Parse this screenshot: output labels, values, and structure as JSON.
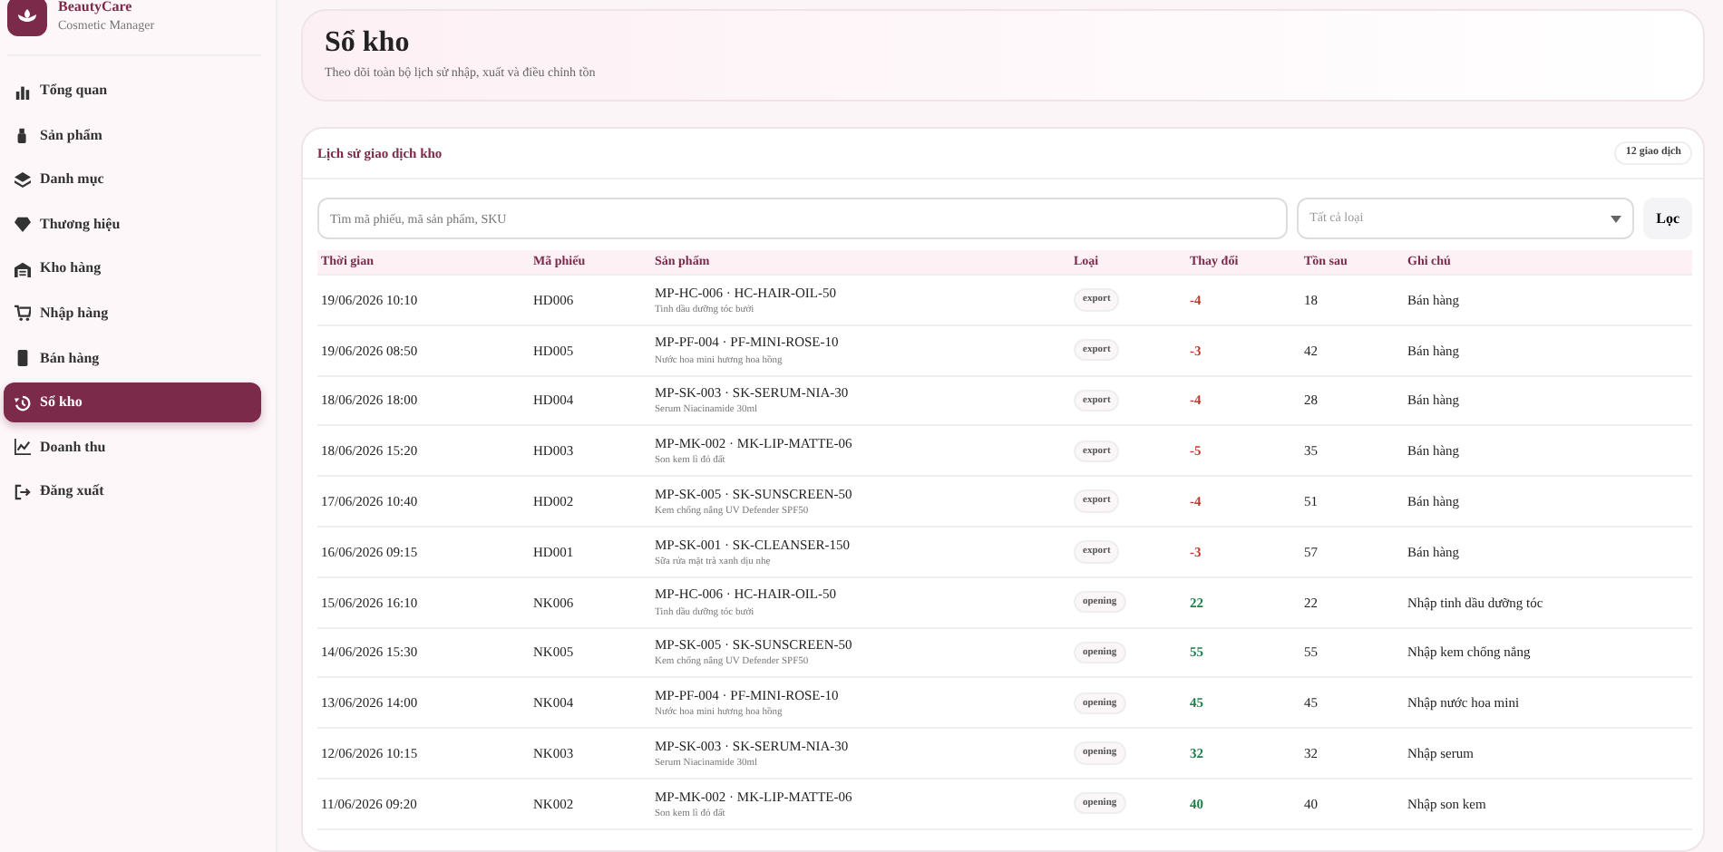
{
  "brand": {
    "name": "BeautyCare",
    "subtitle": "Cosmetic Manager"
  },
  "sidebar": {
    "items": [
      {
        "label": "Tổng quan",
        "selected": false
      },
      {
        "label": "Sản phẩm",
        "selected": false
      },
      {
        "label": "Danh mục",
        "selected": false
      },
      {
        "label": "Thương hiệu",
        "selected": false
      },
      {
        "label": "Kho hàng",
        "selected": false
      },
      {
        "label": "Nhập hàng",
        "selected": false
      },
      {
        "label": "Bán hàng",
        "selected": false
      },
      {
        "label": "Sổ kho",
        "selected": true
      },
      {
        "label": "Doanh thu",
        "selected": false
      },
      {
        "label": "Đăng xuất",
        "selected": false
      }
    ]
  },
  "header": {
    "title": "Sổ kho",
    "subtitle": "Theo dõi toàn bộ lịch sử nhập, xuất và điều chỉnh tồn"
  },
  "panel": {
    "title": "Lịch sử giao dịch kho",
    "count": "12 giao dịch"
  },
  "filters": {
    "search_placeholder": "Tìm mã phiếu, mã sản phẩm, SKU",
    "type_placeholder": "Tất cả loại",
    "button": "Lọc"
  },
  "table": {
    "columns": [
      "Thời gian",
      "Mã phiếu",
      "Sản phẩm",
      "Loại",
      "Thay đổi",
      "Tồn sau",
      "Ghi chú"
    ],
    "rows": [
      {
        "time": "19/06/2026 10:10",
        "code": "HD006",
        "product": "MP-HC-006 · HC-HAIR-OIL-50",
        "product_name": "Tinh dầu dưỡng tóc bưởi",
        "kind": "export",
        "type": "export",
        "change": "-4",
        "after": "18",
        "note": "Bán hàng"
      },
      {
        "time": "19/06/2026 08:50",
        "code": "HD005",
        "product": "MP-PF-004 · PF-MINI-ROSE-10",
        "product_name": "Nước hoa mini hương hoa hồng",
        "kind": "export",
        "type": "export",
        "change": "-3",
        "after": "42",
        "note": "Bán hàng"
      },
      {
        "time": "18/06/2026 18:00",
        "code": "HD004",
        "product": "MP-SK-003 · SK-SERUM-NIA-30",
        "product_name": "Serum Niacinamide 30ml",
        "kind": "export",
        "type": "export",
        "change": "-4",
        "after": "28",
        "note": "Bán hàng"
      },
      {
        "time": "18/06/2026 15:20",
        "code": "HD003",
        "product": "MP-MK-002 · MK-LIP-MATTE-06",
        "product_name": "Son kem lì đỏ đất",
        "kind": "export",
        "type": "export",
        "change": "-5",
        "after": "35",
        "note": "Bán hàng"
      },
      {
        "time": "17/06/2026 10:40",
        "code": "HD002",
        "product": "MP-SK-005 · SK-SUNSCREEN-50",
        "product_name": "Kem chống nắng UV Defender SPF50",
        "kind": "export",
        "type": "export",
        "change": "-4",
        "after": "51",
        "note": "Bán hàng"
      },
      {
        "time": "16/06/2026 09:15",
        "code": "HD001",
        "product": "MP-SK-001 · SK-CLEANSER-150",
        "product_name": "Sữa rửa mặt trà xanh dịu nhẹ",
        "kind": "export",
        "type": "export",
        "change": "-3",
        "after": "57",
        "note": "Bán hàng"
      },
      {
        "time": "15/06/2026 16:10",
        "code": "NK006",
        "product": "MP-HC-006 · HC-HAIR-OIL-50",
        "product_name": "Tinh dầu dưỡng tóc bưởi",
        "kind": "opening",
        "type": "opening",
        "change": "22",
        "after": "22",
        "note": "Nhập tinh dầu dưỡng tóc"
      },
      {
        "time": "14/06/2026 15:30",
        "code": "NK005",
        "product": "MP-SK-005 · SK-SUNSCREEN-50",
        "product_name": "Kem chống nắng UV Defender SPF50",
        "kind": "opening",
        "type": "opening",
        "change": "55",
        "after": "55",
        "note": "Nhập kem chống nắng"
      },
      {
        "time": "13/06/2026 14:00",
        "code": "NK004",
        "product": "MP-PF-004 · PF-MINI-ROSE-10",
        "product_name": "Nước hoa mini hương hoa hồng",
        "kind": "opening",
        "type": "opening",
        "change": "45",
        "after": "45",
        "note": "Nhập nước hoa mini"
      },
      {
        "time": "12/06/2026 10:15",
        "code": "NK003",
        "product": "MP-SK-003 · SK-SERUM-NIA-30",
        "product_name": "Serum Niacinamide 30ml",
        "kind": "opening",
        "type": "opening",
        "change": "32",
        "after": "32",
        "note": "Nhập serum"
      },
      {
        "time": "11/06/2026 09:20",
        "code": "NK002",
        "product": "MP-MK-002 · MK-LIP-MATTE-06",
        "product_name": "Son kem lì đỏ đất",
        "kind": "opening",
        "type": "opening",
        "change": "40",
        "after": "40",
        "note": "Nhập son kem"
      }
    ]
  }
}
